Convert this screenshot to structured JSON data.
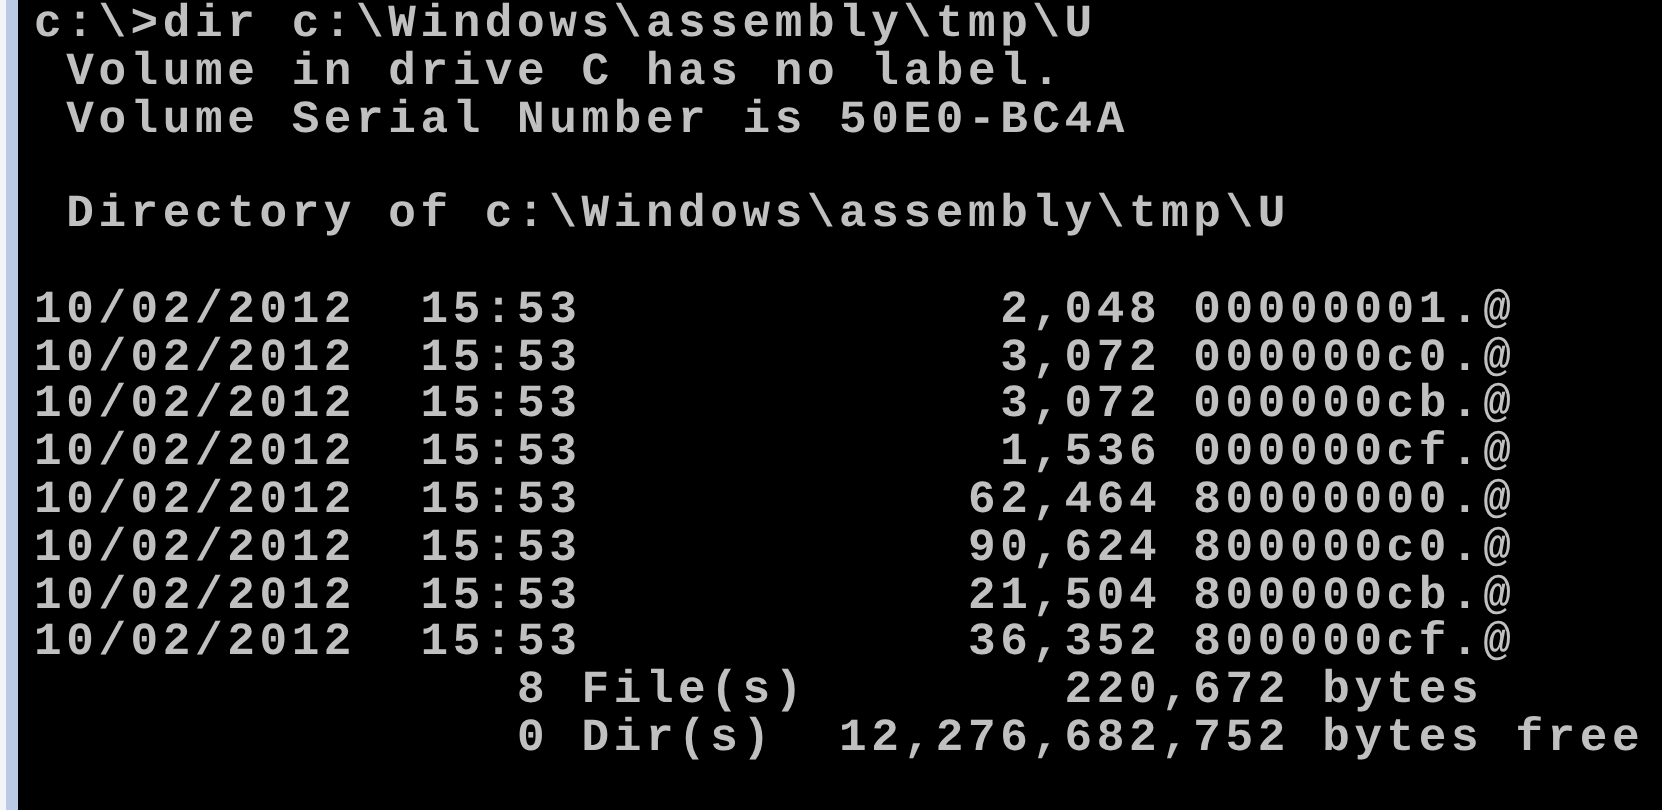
{
  "console": {
    "lines": [
      {
        "kind": "text",
        "text": "c:\\>dir c:\\Windows\\assembly\\tmp\\U"
      },
      {
        "kind": "text",
        "text": " Volume in drive C has no label."
      },
      {
        "kind": "text",
        "text": " Volume Serial Number is 50E0-BC4A"
      },
      {
        "kind": "blank"
      },
      {
        "kind": "text",
        "text": " Directory of c:\\Windows\\assembly\\tmp\\U"
      },
      {
        "kind": "blank"
      },
      {
        "kind": "text",
        "text": "10/02/2012  15:53             2,048 00000001.@"
      },
      {
        "kind": "text",
        "text": "10/02/2012  15:53             3,072 000000c0.@"
      },
      {
        "kind": "text",
        "text": "10/02/2012  15:53             3,072 000000cb.@"
      },
      {
        "kind": "text",
        "text": "10/02/2012  15:53             1,536 000000cf.@"
      },
      {
        "kind": "text",
        "text": "10/02/2012  15:53            62,464 80000000.@"
      },
      {
        "kind": "text",
        "text": "10/02/2012  15:53            90,624 800000c0.@"
      },
      {
        "kind": "text",
        "text": "10/02/2012  15:53            21,504 800000cb.@"
      },
      {
        "kind": "text",
        "text": "10/02/2012  15:53            36,352 800000cf.@"
      },
      {
        "kind": "text",
        "text": "               8 File(s)        220,672 bytes"
      },
      {
        "kind": "text",
        "text": "               0 Dir(s)  12,276,682,752 bytes free"
      }
    ]
  }
}
